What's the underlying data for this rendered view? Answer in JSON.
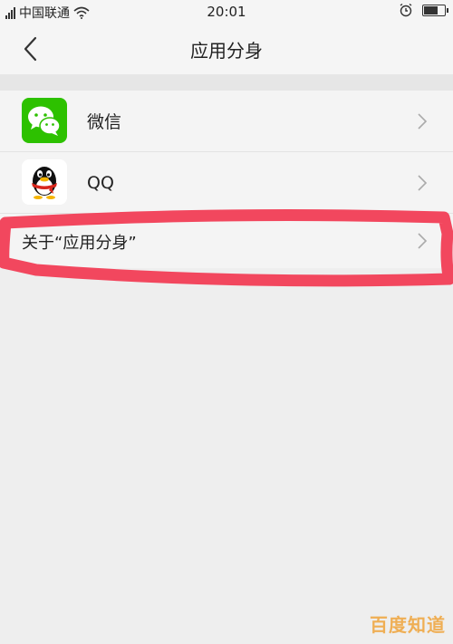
{
  "status_bar": {
    "carrier": "中国联通",
    "time": "20:01",
    "battery_level": 0.75
  },
  "header": {
    "title": "应用分身"
  },
  "apps": [
    {
      "name": "微信",
      "icon": "wechat-icon",
      "color": "#2dc100"
    },
    {
      "name": "QQ",
      "icon": "qq-penguin-icon",
      "color": "#111111"
    }
  ],
  "about": {
    "label": "关于“应用分身”"
  },
  "annotation_color": "#f2475e",
  "watermark": "百度知道"
}
